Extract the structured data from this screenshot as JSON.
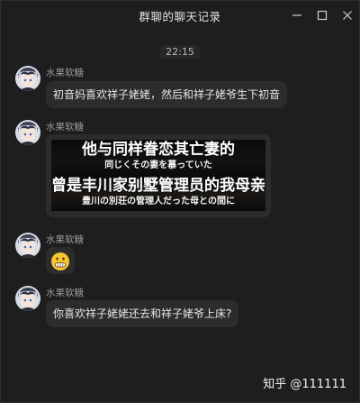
{
  "window": {
    "title": "群聊的聊天记录",
    "buttons": [
      "minimize-icon",
      "maximize-icon",
      "close-icon"
    ]
  },
  "timestamp": "22:15",
  "messages": [
    {
      "sender": "水果软糖",
      "type": "text",
      "text": "初音妈喜欢祥子姥姥，然后和祥子姥爷生下初音"
    },
    {
      "sender": "水果软糖",
      "type": "image",
      "caption1_main": "他与同样眷恋其亡妻的",
      "caption1_sub": "同じくその妻を慕っていた",
      "caption2_main": "曾是丰川家别墅管理员的我母亲",
      "caption2_sub": "豊川の別荘の管理人だった母との間に"
    },
    {
      "sender": "水果软糖",
      "type": "emoji",
      "icon": "grimace-emoji-icon"
    },
    {
      "sender": "水果软糖",
      "type": "text",
      "text": "你喜欢祥子姥姥还去和祥子姥爷上床?"
    }
  ],
  "watermark": "知乎 @111111",
  "colors": {
    "background": "#1e1e1e",
    "bubble": "#2c2c2c",
    "sender": "#9a9a9a",
    "emoji": "#f6c630"
  }
}
